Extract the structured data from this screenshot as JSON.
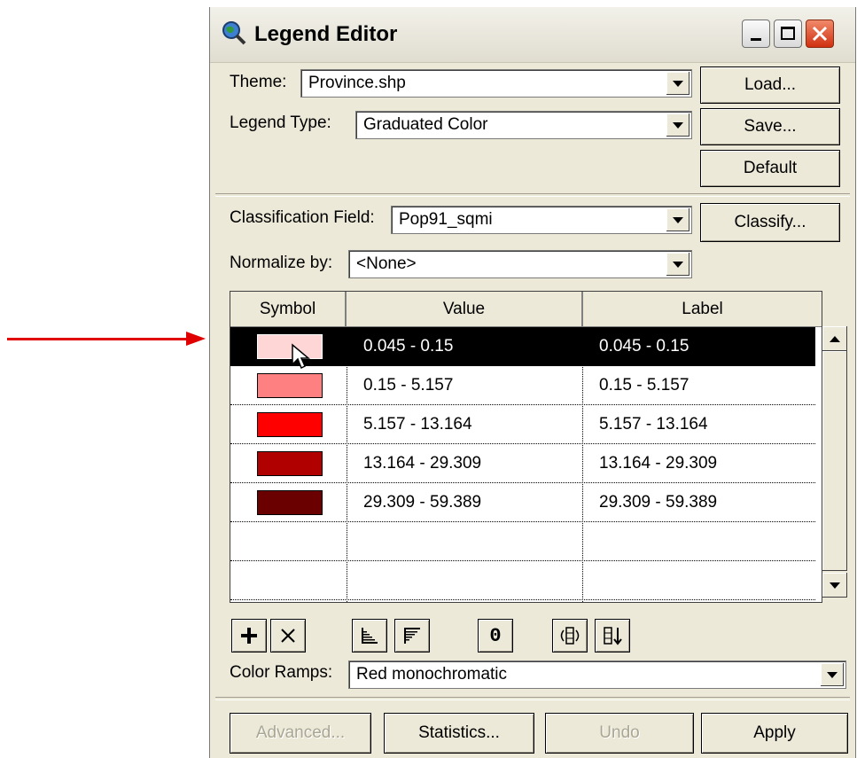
{
  "window": {
    "title": "Legend Editor"
  },
  "theme": {
    "label": "Theme:",
    "value": "Province.shp"
  },
  "legend_type": {
    "label": "Legend Type:",
    "value": "Graduated Color"
  },
  "buttons": {
    "load": "Load...",
    "save": "Save...",
    "default": "Default",
    "classify": "Classify..."
  },
  "classification": {
    "label": "Classification Field:",
    "value": "Pop91_sqmi"
  },
  "normalize": {
    "label": "Normalize by:",
    "value": "<None>"
  },
  "table": {
    "headers": {
      "symbol": "Symbol",
      "value": "Value",
      "label": "Label"
    },
    "rows": [
      {
        "value": "0.045 - 0.15",
        "label": "0.045 - 0.15",
        "color": "#ffd6d6",
        "selected": true
      },
      {
        "value": "0.15 - 5.157",
        "label": "0.15 - 5.157",
        "color": "#ff8080",
        "selected": false
      },
      {
        "value": "5.157 - 13.164",
        "label": "5.157 - 13.164",
        "color": "#ff0000",
        "selected": false
      },
      {
        "value": "13.164 - 29.309",
        "label": "13.164 - 29.309",
        "color": "#b00000",
        "selected": false
      },
      {
        "value": "29.309 - 59.389",
        "label": "29.309 - 59.389",
        "color": "#6a0000",
        "selected": false
      }
    ]
  },
  "toolbar": {
    "add_icon": "plus-icon",
    "delete_icon": "x-icon",
    "sort_asc_icon": "sort-ascending-icon",
    "sort_desc_icon": "sort-descending-icon",
    "null_label": "0",
    "flip_icon": "flip-symbols-icon",
    "sort_icon": "sort-values-icon"
  },
  "color_ramps": {
    "label": "Color Ramps:",
    "value": "Red monochromatic"
  },
  "bottom_buttons": {
    "advanced": "Advanced...",
    "statistics": "Statistics...",
    "undo": "Undo",
    "apply": "Apply"
  },
  "colors": {
    "pointer_arrow": "#e00000",
    "selection": "#000000"
  }
}
